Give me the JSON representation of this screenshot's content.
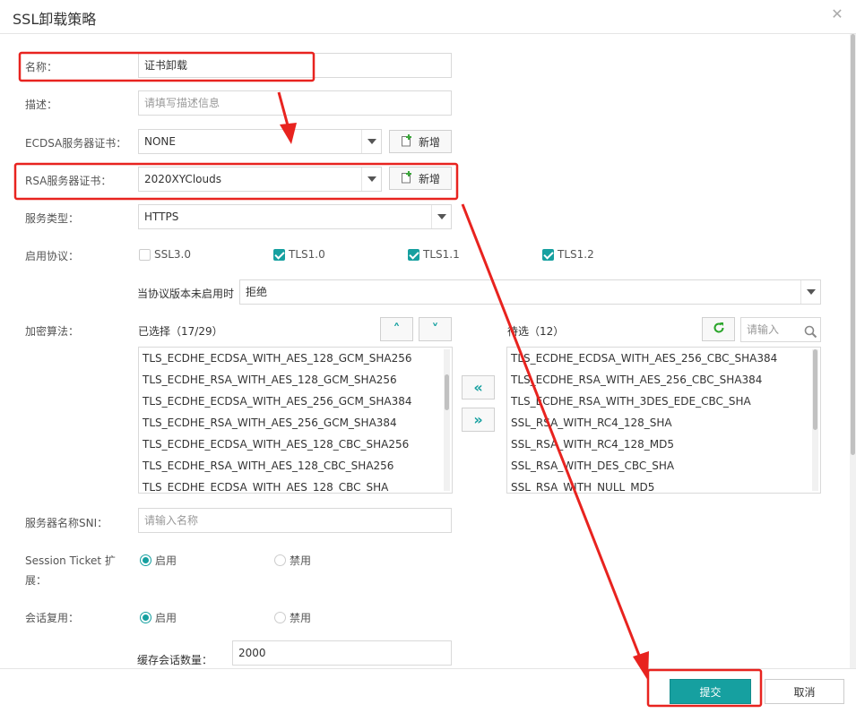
{
  "dialog": {
    "title": "SSL卸载策略"
  },
  "form": {
    "name": {
      "label": "名称：",
      "value": "证书卸载"
    },
    "desc": {
      "label": "描述：",
      "placeholder": "请填写描述信息"
    },
    "ecdsa_cert": {
      "label": "ECDSA服务器证书：",
      "value": "NONE",
      "new_label": "新增"
    },
    "rsa_cert": {
      "label": "RSA服务器证书：",
      "value": "2020XYClouds",
      "new_label": "新增"
    },
    "service_type": {
      "label": "服务类型：",
      "value": "HTTPS"
    },
    "protocols": {
      "label": "启用协议：",
      "options": [
        {
          "label": "SSL3.0",
          "checked": false
        },
        {
          "label": "TLS1.0",
          "checked": true
        },
        {
          "label": "TLS1.1",
          "checked": true
        },
        {
          "label": "TLS1.2",
          "checked": true
        }
      ],
      "fallback_label": "当协议版本未启用时",
      "fallback_value": "拒绝"
    },
    "ciphers": {
      "label": "加密算法：",
      "selected_title": "已选择（17/29）",
      "pending_title": "待选（12）",
      "search_placeholder": "请输入",
      "selected": [
        "TLS_ECDHE_ECDSA_WITH_AES_128_GCM_SHA256",
        "TLS_ECDHE_RSA_WITH_AES_128_GCM_SHA256",
        "TLS_ECDHE_ECDSA_WITH_AES_256_GCM_SHA384",
        "TLS_ECDHE_RSA_WITH_AES_256_GCM_SHA384",
        "TLS_ECDHE_ECDSA_WITH_AES_128_CBC_SHA256",
        "TLS_ECDHE_RSA_WITH_AES_128_CBC_SHA256",
        "TLS_ECDHE_ECDSA_WITH_AES_128_CBC_SHA"
      ],
      "pending": [
        "TLS_ECDHE_ECDSA_WITH_AES_256_CBC_SHA384",
        "TLS_ECDHE_RSA_WITH_AES_256_CBC_SHA384",
        "TLS_ECDHE_RSA_WITH_3DES_EDE_CBC_SHA",
        "SSL_RSA_WITH_RC4_128_SHA",
        "SSL_RSA_WITH_RC4_128_MD5",
        "SSL_RSA_WITH_DES_CBC_SHA",
        "SSL_RSA_WITH_NULL_MD5"
      ],
      "move_left": "«",
      "move_right": "»"
    },
    "sni": {
      "label": "服务器名称SNI：",
      "placeholder": "请输入名称"
    },
    "session_ticket": {
      "label_line1": "Session Ticket 扩",
      "label_line2": "展：",
      "enable": "启用",
      "disable": "禁用"
    },
    "session_reuse": {
      "label": "会话复用：",
      "enable": "启用",
      "disable": "禁用"
    },
    "cache_count": {
      "label": "缓存会话数量：",
      "value": "2000"
    }
  },
  "footer": {
    "submit": "提交",
    "cancel": "取消"
  },
  "colors": {
    "accent": "#16a0a0",
    "annotation": "#e8231f"
  }
}
